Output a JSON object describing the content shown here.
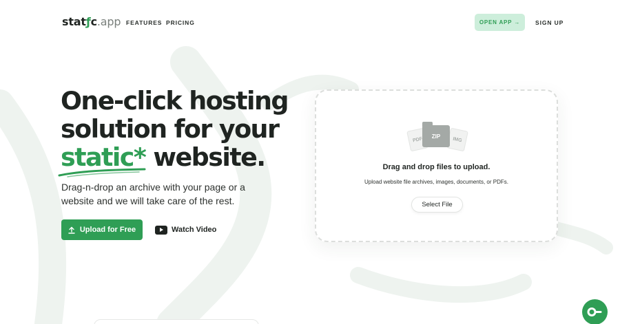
{
  "brand": {
    "logo_prefix": "stat",
    "logo_accent": "ƒ",
    "logo_mid": "c",
    "logo_suffix": ".app",
    "accent_color": "#2f9e55",
    "light_accent_color": "#cdeedb"
  },
  "nav": {
    "features": "FEATURES",
    "pricing": "PRICING",
    "open_app": "OPEN APP",
    "open_app_icon": "→",
    "sign_up": "SIGN UP"
  },
  "hero": {
    "title_line1": "One-click hosting",
    "title_line2": "solution for your",
    "title_highlight": "static*",
    "title_end": " website.",
    "subtitle": "Drag-n-drop an archive with your page or a website and we will take care of the rest.",
    "upload_button": "Upload for Free",
    "watch_video": "Watch Video"
  },
  "dropzone": {
    "file_labels": {
      "pdf": "PDF",
      "zip": "ZIP",
      "img": "IMG"
    },
    "title": "Drag and drop files to upload.",
    "subtitle": "Upload website file archives, images, documents, or PDFs.",
    "select_button": "Select File"
  },
  "icons": {
    "upload": "upload-icon",
    "video": "youtube-icon",
    "chat": "chat-icon"
  }
}
